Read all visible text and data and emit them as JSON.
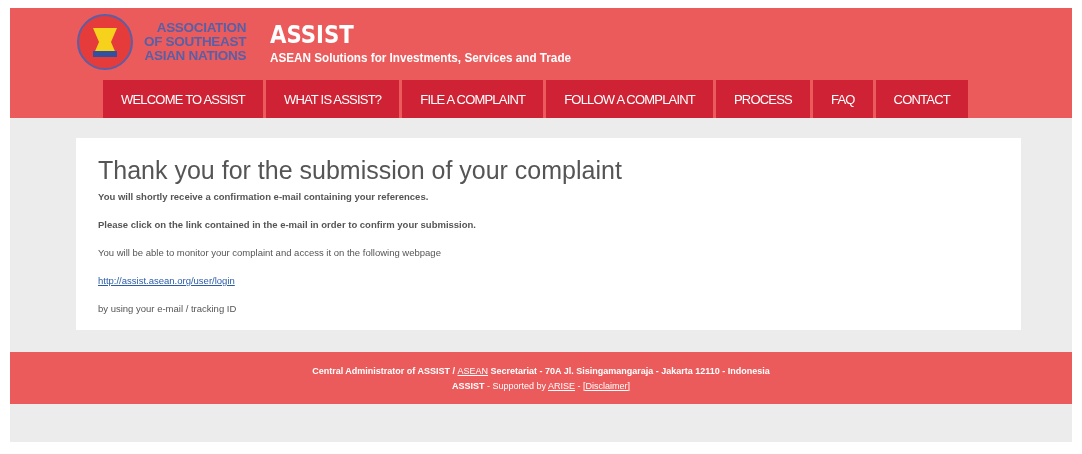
{
  "header": {
    "org_lines": [
      "ASSOCIATION",
      "OF SOUTHEAST",
      "ASIAN NATIONS"
    ],
    "title": "ASSIST",
    "subtitle": "ASEAN Solutions for Investments, Services and Trade"
  },
  "nav": [
    "WELCOME TO ASSIST",
    "WHAT IS ASSIST?",
    "FILE A COMPLAINT",
    "FOLLOW A COMPLAINT",
    "PROCESS",
    "FAQ",
    "CONTACT"
  ],
  "content": {
    "heading": "Thank you for the submission of your complaint",
    "paragraphs": [
      {
        "kind": "bold",
        "text": "You will shortly receive a confirmation e-mail containing your references."
      },
      {
        "kind": "semibold",
        "text": "Please click on the link contained in the e-mail in order to confirm your submission."
      },
      {
        "kind": "text",
        "text": "You will be able to monitor your complaint and access it on the following webpage"
      },
      {
        "kind": "link",
        "text": "http://assist.asean.org/user/login"
      },
      {
        "kind": "text",
        "text": "by using your e-mail / tracking ID"
      }
    ]
  },
  "footer": [
    [
      {
        "kind": "text",
        "text": "Central Administrator of ASSIST / "
      },
      {
        "kind": "link",
        "text": "ASEAN"
      },
      {
        "kind": "text",
        "text": " Secretariat - 70A Jl. Sisingamangaraja - Jakarta 12110 - Indonesia"
      }
    ],
    [
      {
        "kind": "bold",
        "text": "ASSIST"
      },
      {
        "kind": "text",
        "text": " - Supported by "
      },
      {
        "kind": "link",
        "text": "ARISE"
      },
      {
        "kind": "text",
        "text": " - "
      },
      {
        "kind": "link",
        "text": "[Disclaimer]"
      }
    ]
  ]
}
